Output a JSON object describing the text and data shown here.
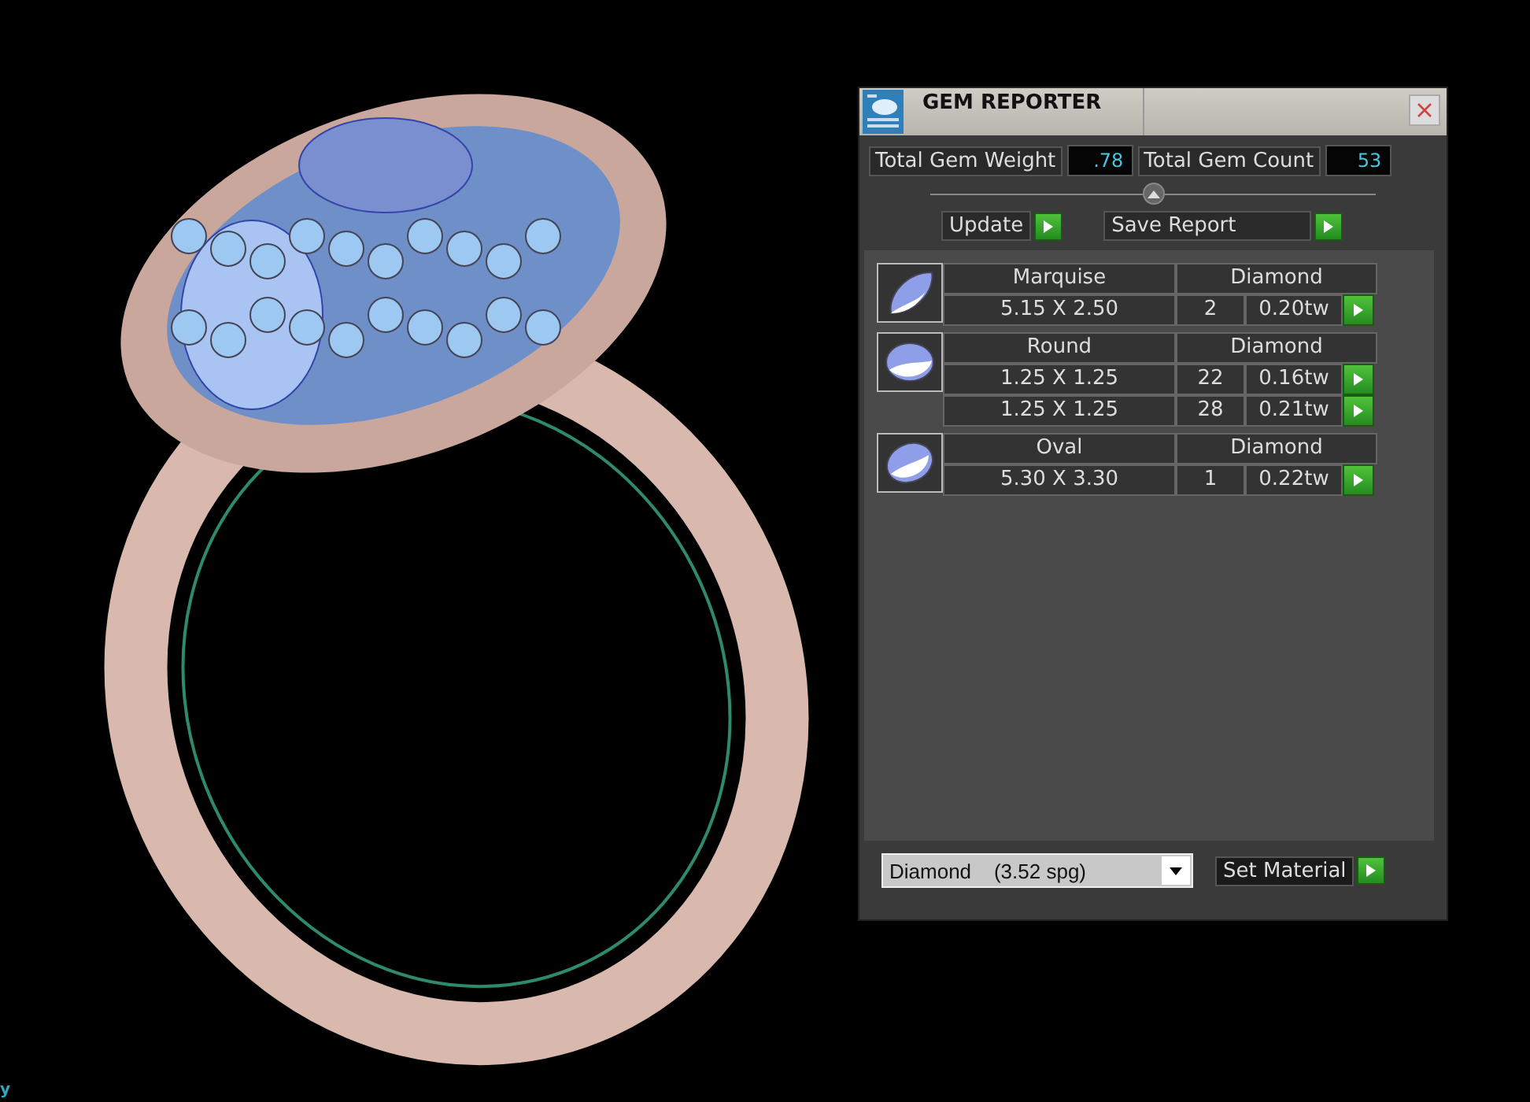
{
  "viewport": {
    "axis_label": "y"
  },
  "panel": {
    "title": "GEM REPORTER",
    "total_weight_label": "Total Gem Weight",
    "total_weight": ".78",
    "total_count_label": "Total Gem Count",
    "total_count": "53",
    "update_label": "Update",
    "save_label": "Save Report",
    "groups": [
      {
        "shape": "Marquise",
        "kind": "marquise",
        "material": "Diamond",
        "rows": [
          {
            "size": "5.15 X 2.50",
            "count": "2",
            "weight": "0.20tw"
          }
        ]
      },
      {
        "shape": "Round",
        "kind": "round",
        "material": "Diamond",
        "rows": [
          {
            "size": "1.25 X 1.25",
            "count": "22",
            "weight": "0.16tw"
          },
          {
            "size": "1.25 X 1.25",
            "count": "28",
            "weight": "0.21tw"
          }
        ]
      },
      {
        "shape": "Oval",
        "kind": "oval",
        "material": "Diamond",
        "rows": [
          {
            "size": "5.30 X 3.30",
            "count": "1",
            "weight": "0.22tw"
          }
        ]
      }
    ],
    "material_select": {
      "value": "Diamond    (3.52 spg)"
    },
    "set_material_label": "Set Material"
  }
}
